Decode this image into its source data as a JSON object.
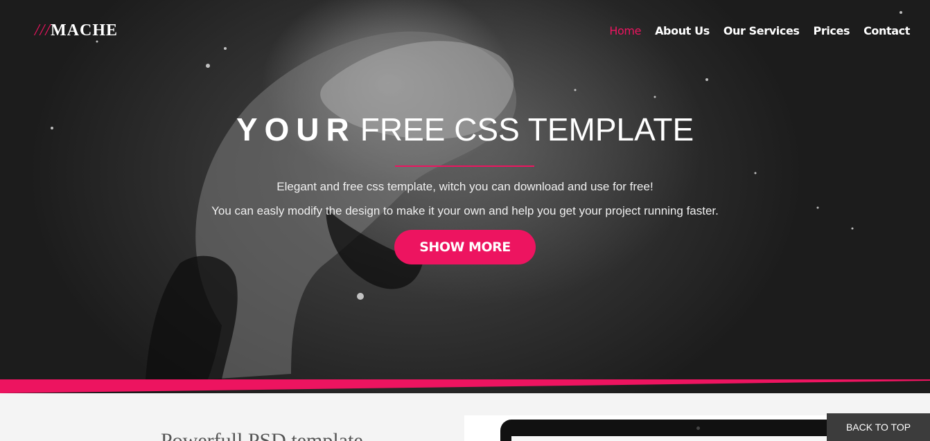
{
  "brand": {
    "slashes": "///",
    "name": "MACHE"
  },
  "nav": {
    "items": [
      {
        "label": "Home",
        "active": true
      },
      {
        "label": "About Us"
      },
      {
        "label": "Our Services"
      },
      {
        "label": "Prices"
      },
      {
        "label": "Contact"
      }
    ]
  },
  "hero": {
    "headline_bold": "YOUR",
    "headline_light": "FREE CSS TEMPLATE",
    "line1": "Elegant and free css template, witch you can download and use for free!",
    "line2": "You can easly modify the design to make it your own and help you get your project running faster.",
    "button_label": "SHOW MORE"
  },
  "section": {
    "title": "Powerfull PSD template"
  },
  "back_to_top": "BACK TO TOP",
  "colors": {
    "accent": "#ed1460",
    "hero_dark": "#1c1c1c",
    "footer_btn": "#3c3c3c"
  }
}
